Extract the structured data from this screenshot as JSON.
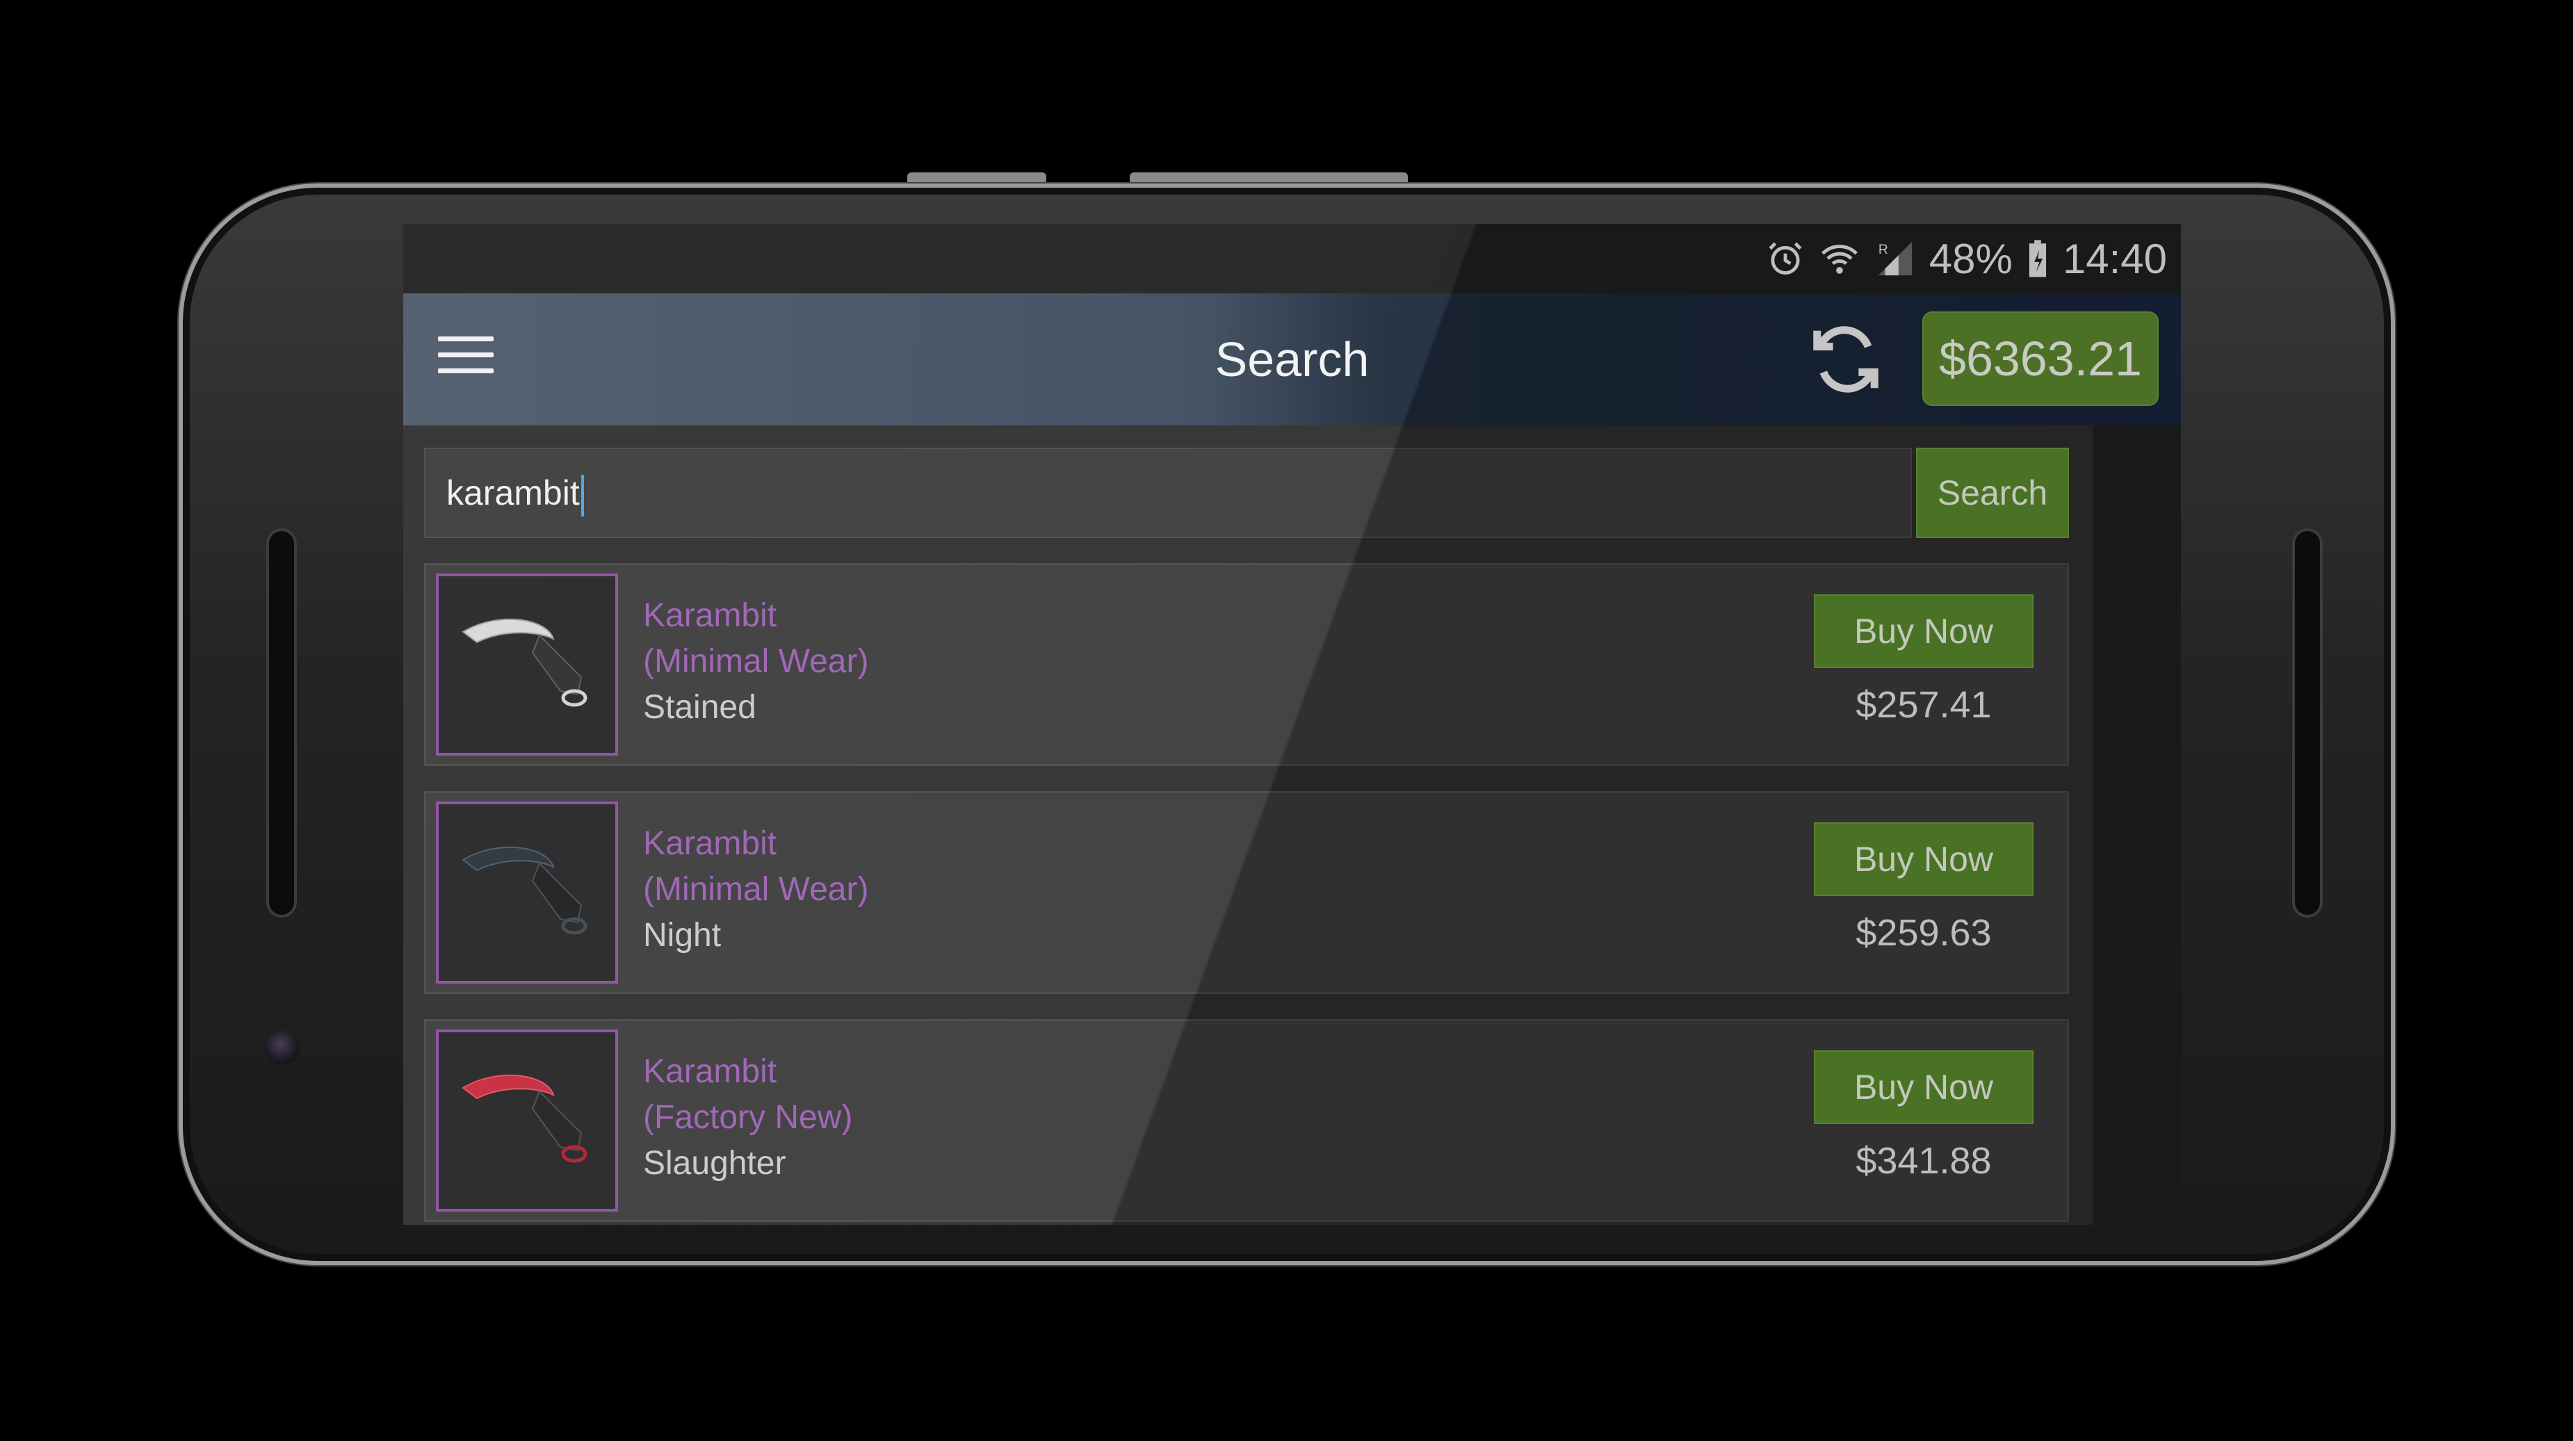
{
  "status_bar": {
    "battery": "48%",
    "time": "14:40",
    "icons": [
      "alarm-icon",
      "wifi-icon",
      "signal-icon",
      "battery-icon"
    ]
  },
  "app_bar": {
    "title": "Search",
    "balance": "$6363.21",
    "icons": [
      "menu-icon",
      "refresh-icon"
    ]
  },
  "search": {
    "value": "karambit",
    "button_label": "Search"
  },
  "items": [
    {
      "name": "Karambit",
      "wear": "(Minimal Wear)",
      "skin": "Stained",
      "button": "Buy Now",
      "price": "$257.41",
      "blade": "#d8d8d8"
    },
    {
      "name": "Karambit",
      "wear": "(Minimal Wear)",
      "skin": "Night",
      "button": "Buy Now",
      "price": "$259.63",
      "blade": "#222a33"
    },
    {
      "name": "Karambit",
      "wear": "(Factory New)",
      "skin": "Slaughter",
      "button": "Buy Now",
      "price": "$341.88",
      "blade": "#c7263a"
    }
  ],
  "colors": {
    "accent_green": "#5a8b2c",
    "rarity_purple": "#9b5fb2",
    "appbar": "#3b4a5c"
  }
}
